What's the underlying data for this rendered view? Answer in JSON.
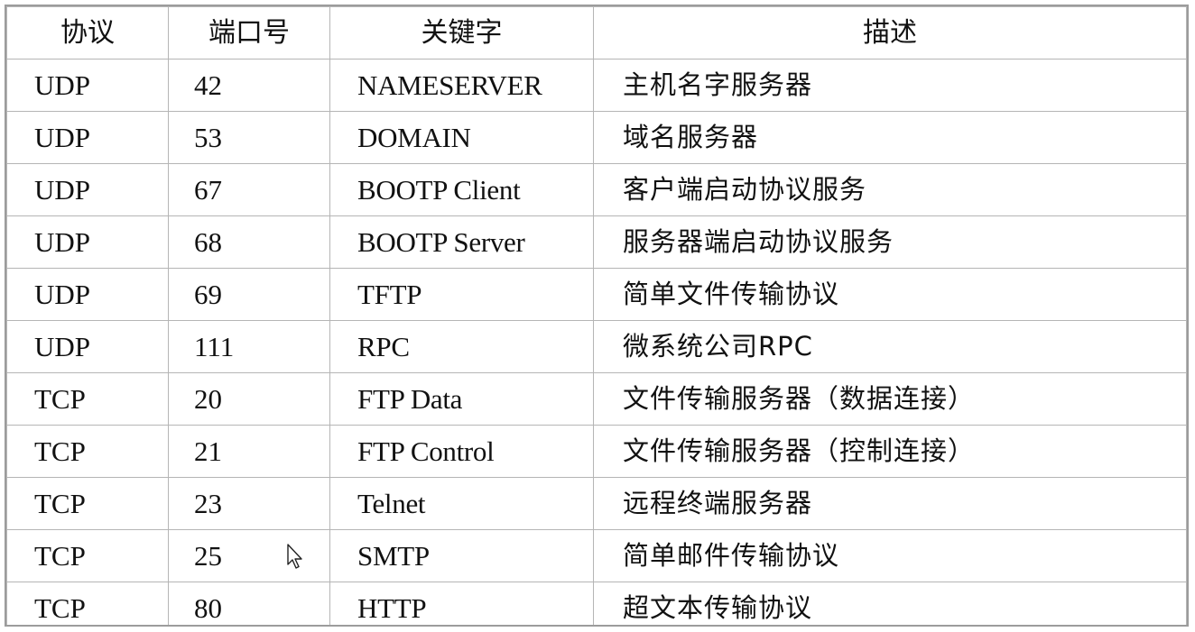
{
  "table": {
    "headers": [
      "协议",
      "端口号",
      "关键字",
      "描述"
    ],
    "rows": [
      {
        "protocol": "UDP",
        "port": "42",
        "keyword": "NAMESERVER",
        "description": "主机名字服务器"
      },
      {
        "protocol": "UDP",
        "port": "53",
        "keyword": "DOMAIN",
        "description": "域名服务器"
      },
      {
        "protocol": "UDP",
        "port": "67",
        "keyword": "BOOTP Client",
        "description": "客户端启动协议服务"
      },
      {
        "protocol": "UDP",
        "port": "68",
        "keyword": "BOOTP Server",
        "description": "服务器端启动协议服务"
      },
      {
        "protocol": "UDP",
        "port": "69",
        "keyword": "TFTP",
        "description": "简单文件传输协议"
      },
      {
        "protocol": "UDP",
        "port": "111",
        "keyword": "RPC",
        "description": "微系统公司RPC"
      },
      {
        "protocol": "TCP",
        "port": "20",
        "keyword": "FTP Data",
        "description": "文件传输服务器（数据连接）"
      },
      {
        "protocol": "TCP",
        "port": "21",
        "keyword": "FTP Control",
        "description": "文件传输服务器（控制连接）"
      },
      {
        "protocol": "TCP",
        "port": "23",
        "keyword": "Telnet",
        "description": "远程终端服务器"
      },
      {
        "protocol": "TCP",
        "port": "25",
        "keyword": "SMTP",
        "description": "简单邮件传输协议"
      },
      {
        "protocol": "TCP",
        "port": "80",
        "keyword": "HTTP",
        "description": "超文本传输协议"
      }
    ]
  },
  "colors": {
    "border": "#b5b5b5",
    "outer_border": "#9c9c9c",
    "text": "#111111",
    "background": "#ffffff"
  },
  "icons": {
    "cursor": "mouse-pointer-icon"
  }
}
